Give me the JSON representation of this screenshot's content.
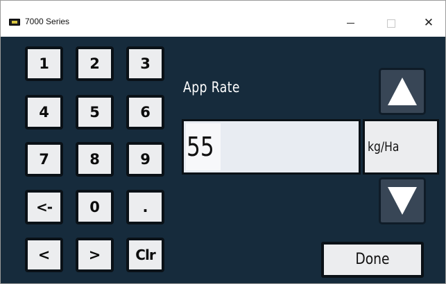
{
  "window": {
    "title": "7000 Series",
    "minimize_icon": "minimize-icon",
    "maximize_icon": "maximize-icon",
    "close_symbol": "✕"
  },
  "keypad": {
    "keys": [
      "1",
      "2",
      "3",
      "4",
      "5",
      "6",
      "7",
      "8",
      "9",
      "<-",
      "0",
      ".",
      "<",
      ">",
      "Clr"
    ]
  },
  "entry": {
    "label": "App Rate",
    "value": "55",
    "unit": "kg/Ha"
  },
  "controls": {
    "up_icon": "triangle-up-icon",
    "down_icon": "triangle-down-icon",
    "done_label": "Done"
  },
  "colors": {
    "background": "#162b3c",
    "key_face": "#ecedef",
    "arrow_button": "#384656"
  }
}
